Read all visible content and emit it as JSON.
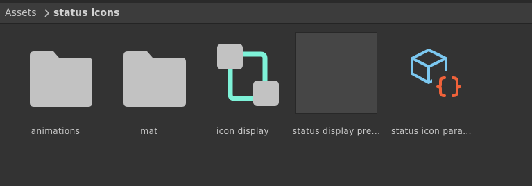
{
  "breadcrumb": {
    "root": "Assets",
    "current": "status icons"
  },
  "assets": [
    {
      "label": "animations",
      "icon": "folder-icon"
    },
    {
      "label": "mat",
      "icon": "folder-icon"
    },
    {
      "label": "icon display",
      "icon": "prefab-variant-icon"
    },
    {
      "label": "status display pre...",
      "icon": "material-preview-thumbnail"
    },
    {
      "label": "status icon para...",
      "icon": "script-cube-icon"
    }
  ],
  "colors": {
    "background": "#333333",
    "toolbar": "#3c3c3c",
    "folder": "#c2c2c2",
    "prefab_connector": "#7ef2d8",
    "script_cube": "#7cc8f0",
    "script_braces": "#f0623a"
  }
}
